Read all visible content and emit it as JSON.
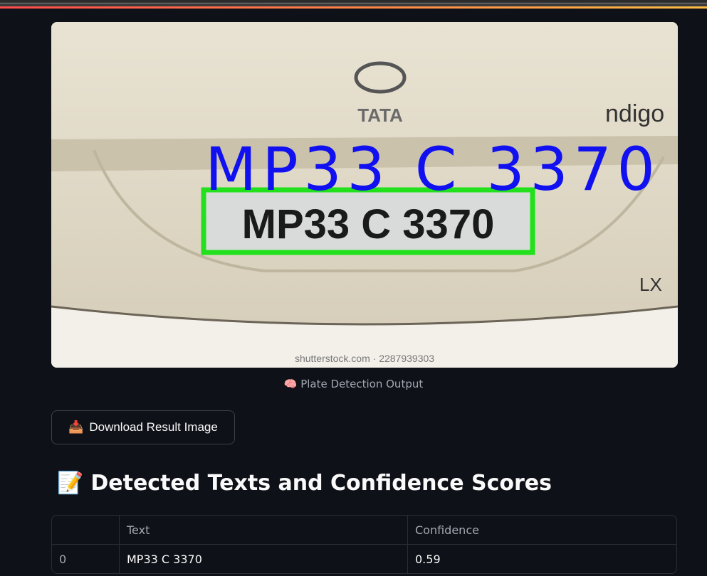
{
  "image": {
    "brand": "TATA",
    "model": "ndigo",
    "badge": "LX",
    "plate": "MP33 C 3370",
    "detected_label": "MP33  C  3370",
    "watermark": "shutterstock.com · 2287939303",
    "caption": "🧠 Plate Detection Output",
    "box_color": "#22e01b",
    "label_color": "#1010f0"
  },
  "download_button": {
    "icon": "📥",
    "label": "Download Result Image"
  },
  "section": {
    "icon": "📝",
    "title": "Detected Texts and Confidence Scores"
  },
  "table": {
    "headers": [
      "",
      "Text",
      "Confidence"
    ],
    "rows": [
      [
        "0",
        "MP33 C 3370",
        "0.59"
      ]
    ]
  }
}
